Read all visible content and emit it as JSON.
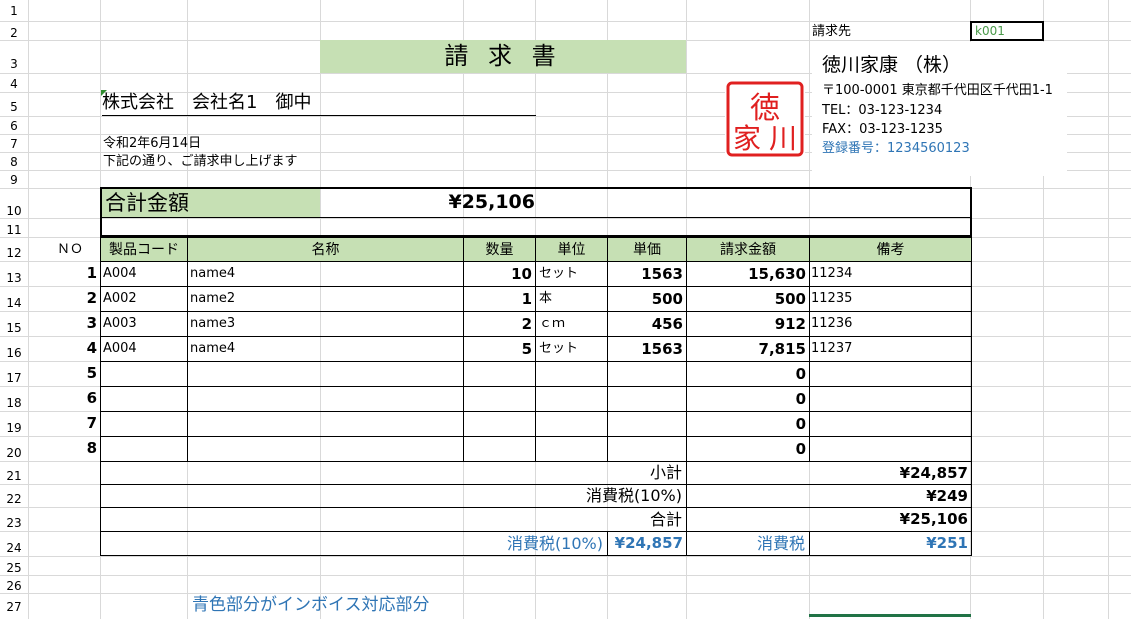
{
  "title": "請 求 書",
  "recipient": "株式会社　会社名1　御中",
  "date": "令和2年6月14日",
  "intro": "下記の通り、ご請求申し上げます",
  "billto_label": "請求先",
  "billto_code": "k001",
  "issuer": {
    "name": "徳川家康 （株）",
    "address": "〒100-0001 東京都千代田区千代田1-1",
    "tel": "TEL：03-123-1234",
    "fax": "FAX：03-123-1235",
    "registration": "登録番号：1234560123",
    "seal_text": "徳川家康"
  },
  "total_label": "合計金額",
  "total_value": "¥25,106",
  "no_label": "ＮＯ",
  "columns": [
    "製品コード",
    "名称",
    "数量",
    "単位",
    "単価",
    "請求金額",
    "備考"
  ],
  "rows": [
    {
      "no": "1",
      "code": "A004",
      "name": "name4",
      "qty": "10",
      "unit": "セット",
      "price": "1563",
      "amount": "15,630",
      "note": "11234"
    },
    {
      "no": "2",
      "code": "A002",
      "name": "name2",
      "qty": "1",
      "unit": "本",
      "price": "500",
      "amount": "500",
      "note": "11235"
    },
    {
      "no": "3",
      "code": "A003",
      "name": "name3",
      "qty": "2",
      "unit": "ｃｍ",
      "price": "456",
      "amount": "912",
      "note": "11236"
    },
    {
      "no": "4",
      "code": "A004",
      "name": "name4",
      "qty": "5",
      "unit": "セット",
      "price": "1563",
      "amount": "7,815",
      "note": "11237"
    },
    {
      "no": "5",
      "code": "",
      "name": "",
      "qty": "",
      "unit": "",
      "price": "",
      "amount": "0",
      "note": ""
    },
    {
      "no": "6",
      "code": "",
      "name": "",
      "qty": "",
      "unit": "",
      "price": "",
      "amount": "0",
      "note": ""
    },
    {
      "no": "7",
      "code": "",
      "name": "",
      "qty": "",
      "unit": "",
      "price": "",
      "amount": "0",
      "note": ""
    },
    {
      "no": "8",
      "code": "",
      "name": "",
      "qty": "",
      "unit": "",
      "price": "",
      "amount": "0",
      "note": ""
    }
  ],
  "subtotal_label": "小計",
  "subtotal_value": "¥24,857",
  "tax_label": "消費税(10%)",
  "tax_value": "¥249",
  "grand_label": "合計",
  "grand_value": "¥25,106",
  "invoice_tax_label": "消費税(10%)",
  "invoice_base_value": "¥24,857",
  "invoice_tax2_label": "消費税",
  "invoice_tax_value": "¥251",
  "note_text": "青色部分がインボイス対応部分",
  "row_numbers": [
    "1",
    "2",
    "3",
    "4",
    "5",
    "6",
    "7",
    "8",
    "9",
    "10",
    "11",
    "12",
    "13",
    "14",
    "15",
    "16",
    "17",
    "18",
    "19",
    "20",
    "21",
    "22",
    "23",
    "24",
    "25",
    "26",
    "27"
  ],
  "colors": {
    "green": "#c6e0b4",
    "blue": "#2f75b5",
    "seal": "#e02020"
  }
}
